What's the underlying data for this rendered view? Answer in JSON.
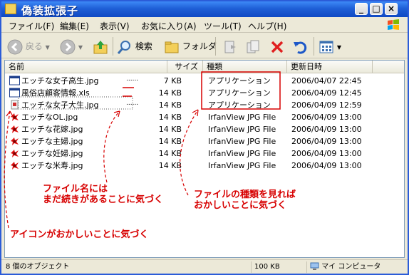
{
  "window": {
    "title": "偽装拡張子"
  },
  "titlebar_buttons": [
    "_",
    "□",
    "×"
  ],
  "menu": [
    "ファイル(F)",
    "編集(E)",
    "表示(V)",
    "お気に入り(A)",
    "ツール(T)",
    "ヘルプ(H)"
  ],
  "toolbar": {
    "back": "戻る",
    "search": "検索",
    "folders": "フォルダ"
  },
  "columns": {
    "name": "名前",
    "size": "サイズ",
    "type": "種類",
    "date": "更新日時"
  },
  "files": [
    {
      "name": "エッチな女子高生.jpg",
      "dots": "......",
      "size": "7 KB",
      "type": "アプリケーション",
      "date": "2006/04/07 22:45",
      "icon": "application-window-icon"
    },
    {
      "name": "風俗店顧客情報.xls",
      "dots": "",
      "size": "14 KB",
      "type": "アプリケーション",
      "date": "2006/04/09 12:45",
      "icon": "application-window-icon"
    },
    {
      "name": "エッチな女子大生.jpg",
      "dots": "......",
      "size": "14 KB",
      "type": "アプリケーション",
      "date": "2006/04/09 12:59",
      "icon": "generic-exe-icon"
    },
    {
      "name": "エッチなOL.jpg",
      "dots": "",
      "size": "14 KB",
      "type": "IrfanView JPG File",
      "date": "2006/04/09 13:00",
      "icon": "irfanview-jpg-icon"
    },
    {
      "name": "エッチな花嫁.jpg",
      "dots": "",
      "size": "14 KB",
      "type": "IrfanView JPG File",
      "date": "2006/04/09 13:00",
      "icon": "irfanview-jpg-icon"
    },
    {
      "name": "エッチな主婦.jpg",
      "dots": "",
      "size": "14 KB",
      "type": "IrfanView JPG File",
      "date": "2006/04/09 13:00",
      "icon": "irfanview-jpg-icon"
    },
    {
      "name": "エッチな妊婦.jpg",
      "dots": "",
      "size": "14 KB",
      "type": "IrfanView JPG File",
      "date": "2006/04/09 13:00",
      "icon": "irfanview-jpg-icon"
    },
    {
      "name": "エッチな米寿.jpg",
      "dots": "",
      "size": "14 KB",
      "type": "IrfanView JPG File",
      "date": "2006/04/09 13:00",
      "icon": "irfanview-jpg-icon"
    }
  ],
  "annotations": {
    "filename_line1": "ファイル名には",
    "filename_line2": "まだ続きがあることに気づく",
    "type_line1": "ファイルの種類を見れば",
    "type_line2": "おかしいことに気づく",
    "icon": "アイコンがおかしいことに気づく"
  },
  "status": {
    "objects": "8 個のオブジェクト",
    "size": "100 KB",
    "location": "マイ コンピュータ"
  },
  "colors": {
    "annotation": "#d70000",
    "title_bar": "#1f5fd6"
  }
}
